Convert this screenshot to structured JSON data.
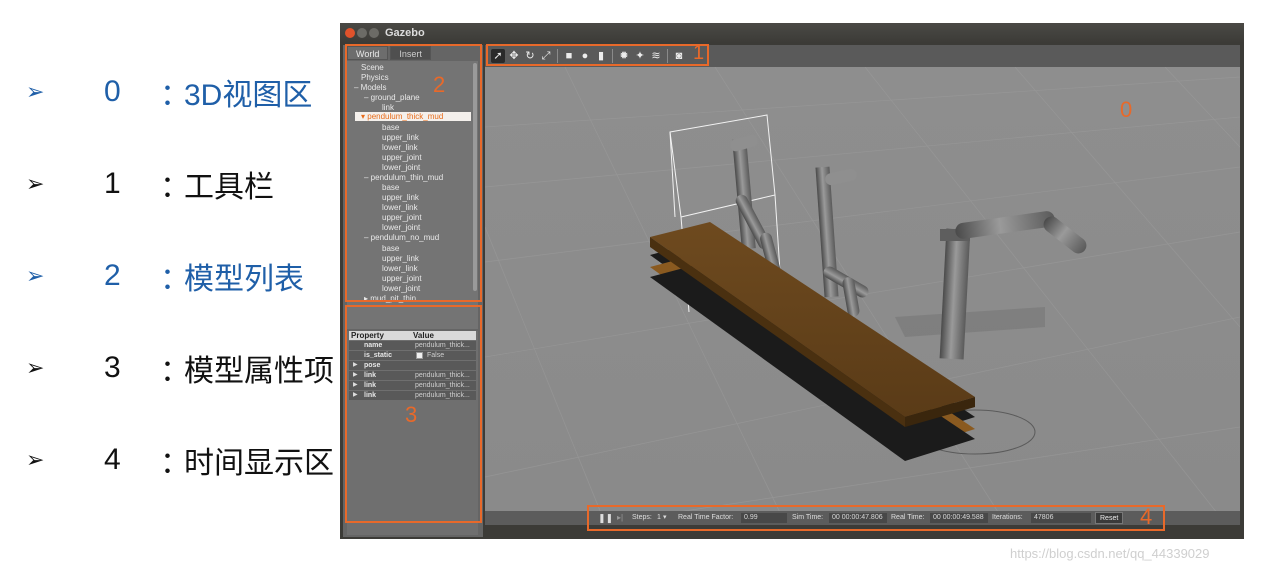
{
  "legend": [
    {
      "num": "0",
      "sep": "：",
      "label": "3D视图区",
      "style": "blue"
    },
    {
      "num": "1",
      "sep": "：",
      "label": "工具栏",
      "style": "black"
    },
    {
      "num": "2",
      "sep": "：",
      "label": "模型列表",
      "style": "blue"
    },
    {
      "num": "3",
      "sep": "：",
      "label": "模型属性项",
      "style": "black"
    },
    {
      "num": "4",
      "sep": "：",
      "label": "时间显示区",
      "style": "black"
    }
  ],
  "legend_arrow": "➢",
  "window": {
    "title": "Gazebo"
  },
  "tabs": {
    "world": "World",
    "insert": "Insert"
  },
  "tree": {
    "scene": "Scene",
    "physics": "Physics",
    "models": "Models",
    "ground_plane": "ground_plane",
    "gp_link": "link",
    "thick": "pendulum_thick_mud",
    "thick_children": [
      "base",
      "upper_link",
      "lower_link",
      "upper_joint",
      "lower_joint"
    ],
    "thin": "pendulum_thin_mud",
    "thin_children": [
      "base",
      "upper_link",
      "lower_link",
      "upper_joint",
      "lower_joint"
    ],
    "no_mud": "pendulum_no_mud",
    "no_mud_children": [
      "base",
      "upper_link",
      "lower_link",
      "upper_joint",
      "lower_joint"
    ],
    "mud_pit": "mud_pit_thin"
  },
  "props": {
    "header_property": "Property",
    "header_value": "Value",
    "rows": [
      {
        "name": "name",
        "value": "pendulum_thick..."
      },
      {
        "name": "is_static",
        "value": "False"
      },
      {
        "name": "pose",
        "value": ""
      },
      {
        "name": "link",
        "value": "pendulum_thick..."
      },
      {
        "name": "link",
        "value": "pendulum_thick..."
      },
      {
        "name": "link",
        "value": "pendulum_thick..."
      }
    ]
  },
  "bottom": {
    "steps_label": "Steps:",
    "steps_value": "1",
    "rtf_label": "Real Time Factor:",
    "rtf_value": "0.99",
    "sim_label": "Sim Time:",
    "sim_value": "00 00:00:47.806",
    "real_label": "Real Time:",
    "real_value": "00 00:00:49.588",
    "iter_label": "Iterations:",
    "iter_value": "47806",
    "reset": "Reset"
  },
  "annotations": {
    "a0": "0",
    "a1": "1",
    "a2": "2",
    "a3": "3",
    "a4": "4"
  },
  "watermark": "https://blog.csdn.net/qq_44339029",
  "colors": {
    "annotation": "#e8692a",
    "accent_blue": "#1f5fa8"
  }
}
